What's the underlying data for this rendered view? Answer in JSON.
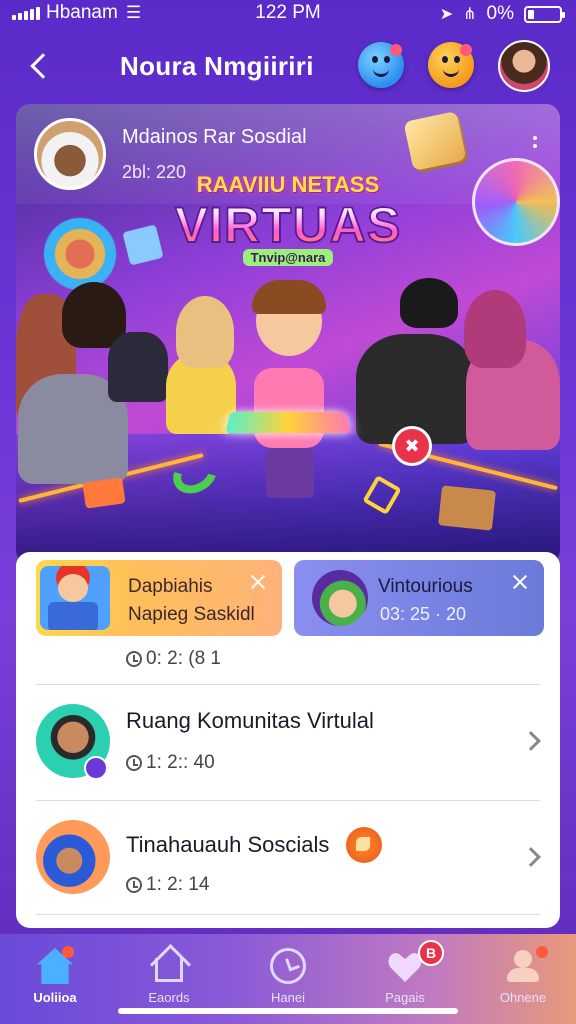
{
  "status_bar": {
    "carrier": "Hbanam",
    "time": "122 PM",
    "battery": "0%"
  },
  "header": {
    "title": "Noura Nmgiiriri"
  },
  "post": {
    "poster_name": "Mdainos Rar Sosdial",
    "time": "2bl: 220",
    "banner_top": "RAAVIIU NETASS",
    "banner_main": "VIRTUAS",
    "banner_sub": "Tnvip@nara"
  },
  "notifications": [
    {
      "title": "Dapbiahis",
      "text": "Napieg Saskidl",
      "time": "0: 2: (8 1"
    },
    {
      "title": "Vintourious",
      "text": "03: 25 · 20"
    }
  ],
  "list_items": [
    {
      "title": "Ruang Komunitas Virtulal",
      "time": "1: 2:: 40"
    },
    {
      "title": "Tinahauauh Soscials",
      "time": "1: 2: 14"
    }
  ],
  "bottom_nav": {
    "items": [
      {
        "label": "Uoliioa",
        "icon": "home-icon"
      },
      {
        "label": "Eaords",
        "icon": "house-icon"
      },
      {
        "label": "Hanei",
        "icon": "clock-icon"
      },
      {
        "label": "Pagais",
        "icon": "heart-icon",
        "badge": "B"
      },
      {
        "label": "Ohnene",
        "icon": "user-icon"
      }
    ]
  },
  "colors": {
    "accent": "#6b35d6",
    "badge": "#e8334a",
    "home_active": "#4ab0ff"
  }
}
